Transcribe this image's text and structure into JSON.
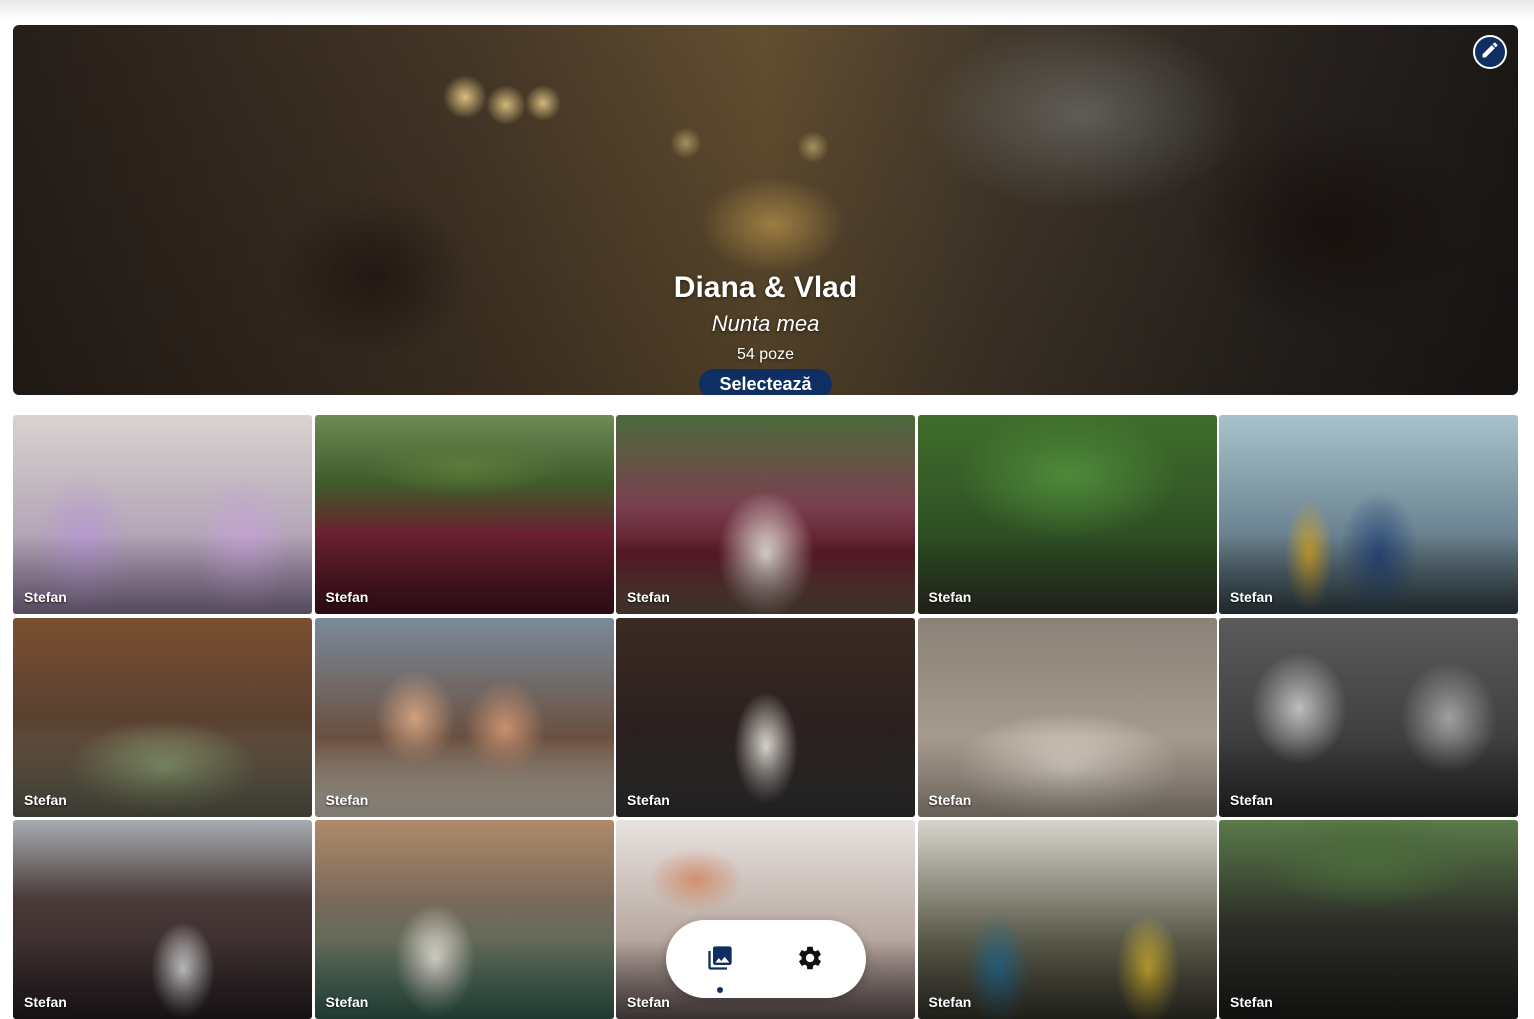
{
  "album": {
    "title": "Diana & Vlad",
    "subtitle": "Nunta mea",
    "photo_count": "54 poze",
    "select_label": "Selectează",
    "edit_icon": "pencil-icon"
  },
  "photos": [
    {
      "author": "Stefan",
      "tone": "bridesmaids in lilac dresses"
    },
    {
      "author": "Stefan",
      "tone": "burgundy dresses in garden"
    },
    {
      "author": "Stefan",
      "tone": "bride with bridesmaids"
    },
    {
      "author": "Stefan",
      "tone": "green trees"
    },
    {
      "author": "Stefan",
      "tone": "couple by the sea"
    },
    {
      "author": "Stefan",
      "tone": "group on rocky beach"
    },
    {
      "author": "Stefan",
      "tone": "laughing women close-up"
    },
    {
      "author": "Stefan",
      "tone": "party with camera"
    },
    {
      "author": "Stefan",
      "tone": "women in robes"
    },
    {
      "author": "Stefan",
      "tone": "black and white laughing"
    },
    {
      "author": "Stefan",
      "tone": "dark room with bride"
    },
    {
      "author": "Stefan",
      "tone": "bride laughing with friends"
    },
    {
      "author": "Stefan",
      "tone": "bride to be balloons"
    },
    {
      "author": "Stefan",
      "tone": "bride with bouquet"
    },
    {
      "author": "Stefan",
      "tone": "large wedding party outdoors"
    }
  ],
  "nav": {
    "gallery_icon": "photo-library-icon",
    "settings_icon": "gear-icon",
    "active": "gallery"
  }
}
